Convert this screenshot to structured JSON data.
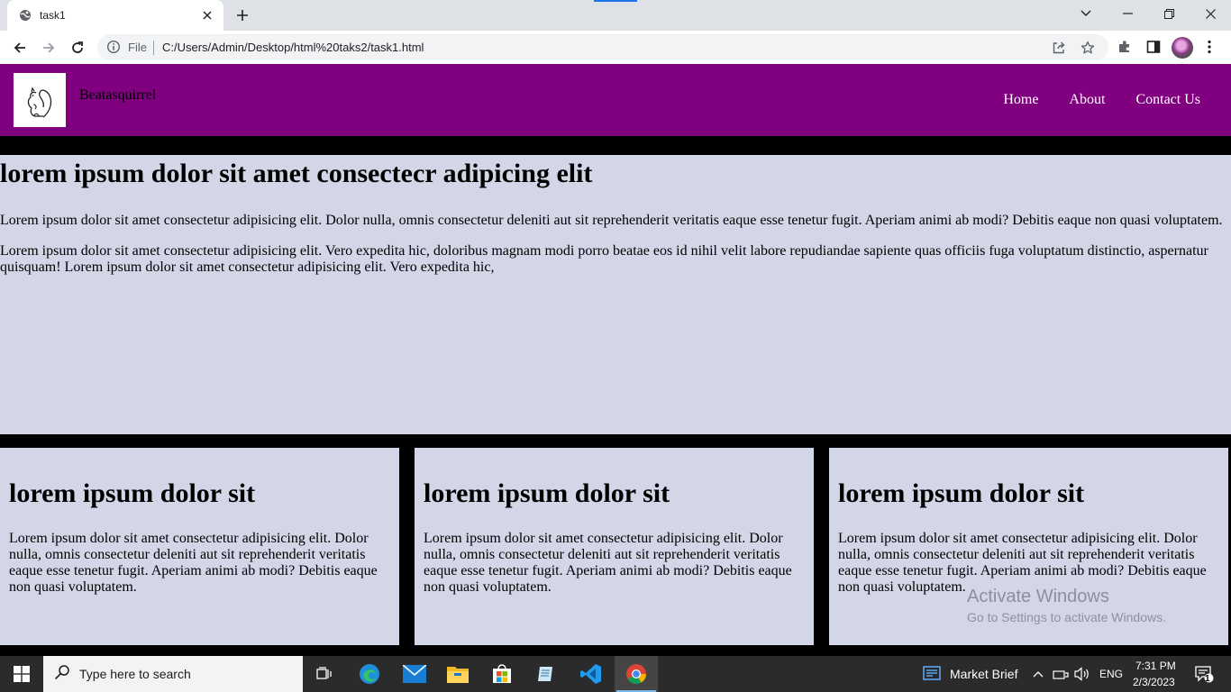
{
  "browser": {
    "tab_title": "task1",
    "url_scheme": "File",
    "url": "C:/Users/Admin/Desktop/html%20taks2/task1.html"
  },
  "site": {
    "brand": "Beatasquirrel",
    "nav": [
      "Home",
      "About",
      "Contact Us"
    ],
    "hero": {
      "heading": "lorem ipsum dolor sit amet consectecr adipicing elit",
      "paragraph1": "Lorem ipsum dolor sit amet consectetur adipisicing elit. Dolor nulla, omnis consectetur deleniti aut sit reprehenderit veritatis eaque esse tenetur fugit. Aperiam animi ab modi? Debitis eaque non quasi voluptatem.",
      "paragraph2": "Lorem ipsum dolor sit amet consectetur adipisicing elit. Vero expedita hic, doloribus magnam modi porro beatae eos id nihil velit labore repudiandae sapiente quas officiis fuga voluptatum distinctio, aspernatur quisquam! Lorem ipsum dolor sit amet consectetur adipisicing elit. Vero expedita hic,"
    },
    "cards": [
      {
        "heading": "lorem ipsum dolor sit",
        "text": "Lorem ipsum dolor sit amet consectetur adipisicing elit. Dolor nulla, omnis consectetur deleniti aut sit reprehenderit veritatis eaque esse tenetur fugit. Aperiam animi ab modi? Debitis eaque non quasi voluptatem."
      },
      {
        "heading": "lorem ipsum dolor sit",
        "text": "Lorem ipsum dolor sit amet consectetur adipisicing elit. Dolor nulla, omnis consectetur deleniti aut sit reprehenderit veritatis eaque esse tenetur fugit. Aperiam animi ab modi? Debitis eaque non quasi voluptatem."
      },
      {
        "heading": "lorem ipsum dolor sit",
        "text": "Lorem ipsum dolor sit amet consectetur adipisicing elit. Dolor nulla, omnis consectetur deleniti aut sit reprehenderit veritatis eaque esse tenetur fugit. Aperiam animi ab modi? Debitis eaque non quasi voluptatem."
      }
    ],
    "colors": {
      "header": "#800080",
      "content_bg": "#d2d6e6",
      "page_bg": "#000000"
    }
  },
  "watermark": {
    "title": "Activate Windows",
    "subtitle": "Go to Settings to activate Windows."
  },
  "taskbar": {
    "search_placeholder": "Type here to search",
    "news_label": "Market Brief",
    "language": "ENG",
    "time": "7:31 PM",
    "date": "2/3/2023",
    "notification_count": "1",
    "apps": [
      "task-view-icon",
      "edge-icon",
      "mail-icon",
      "file-explorer-icon",
      "microsoft-store-icon",
      "notepad-icon",
      "vscode-icon",
      "chrome-icon"
    ]
  }
}
